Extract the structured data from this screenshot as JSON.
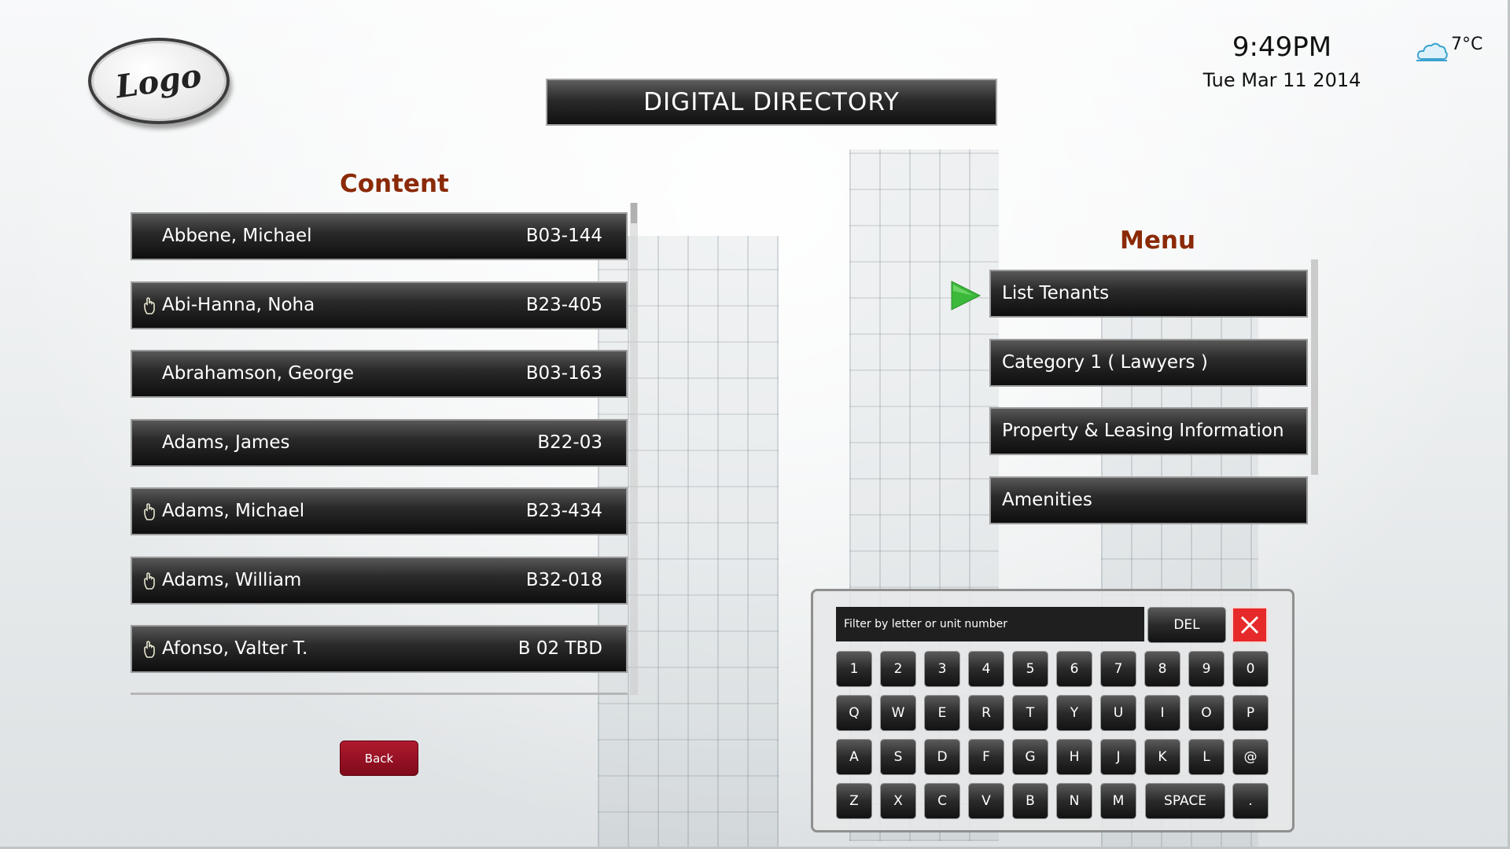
{
  "header": {
    "logo_text": "Logo",
    "title": "DIGITAL DIRECTORY",
    "time": "9:49PM",
    "date": "Tue Mar 11 2014",
    "temperature": "7°C",
    "weather_icon": "cloud-icon"
  },
  "content": {
    "title": "Content",
    "rows": [
      {
        "name": "Abbene, Michael",
        "unit": "B03-144",
        "touch": false
      },
      {
        "name": "Abi-Hanna, Noha",
        "unit": "B23-405",
        "touch": true
      },
      {
        "name": "Abrahamson, George",
        "unit": "B03-163",
        "touch": false
      },
      {
        "name": "Adams, James",
        "unit": "B22-03",
        "touch": false
      },
      {
        "name": "Adams, Michael",
        "unit": "B23-434",
        "touch": true
      },
      {
        "name": "Adams, William",
        "unit": "B32-018",
        "touch": true
      },
      {
        "name": "Afonso, Valter T.",
        "unit": "B 02 TBD",
        "touch": true
      }
    ],
    "back_label": "Back"
  },
  "menu": {
    "title": "Menu",
    "items": [
      {
        "label": "List Tenants",
        "selected": true
      },
      {
        "label": "Category 1 ( Lawyers )",
        "selected": false
      },
      {
        "label": "Property & Leasing Information",
        "selected": false
      },
      {
        "label": "Amenities",
        "selected": false
      }
    ]
  },
  "keyboard": {
    "filter_placeholder": "Filter by letter or unit number",
    "del_label": "DEL",
    "space_label": "SPACE",
    "rows": [
      [
        "1",
        "2",
        "3",
        "4",
        "5",
        "6",
        "7",
        "8",
        "9",
        "0"
      ],
      [
        "Q",
        "W",
        "E",
        "R",
        "T",
        "Y",
        "U",
        "I",
        "O",
        "P"
      ],
      [
        "A",
        "S",
        "D",
        "F",
        "G",
        "H",
        "J",
        "K",
        "L",
        "@"
      ],
      [
        "Z",
        "X",
        "C",
        "V",
        "B",
        "N",
        "M"
      ]
    ],
    "last_key": "."
  },
  "colors": {
    "section_title": "#8b2a08",
    "back_button": "#9a1224",
    "close_button": "#e62a2a",
    "arrow": "#3cb83a"
  }
}
